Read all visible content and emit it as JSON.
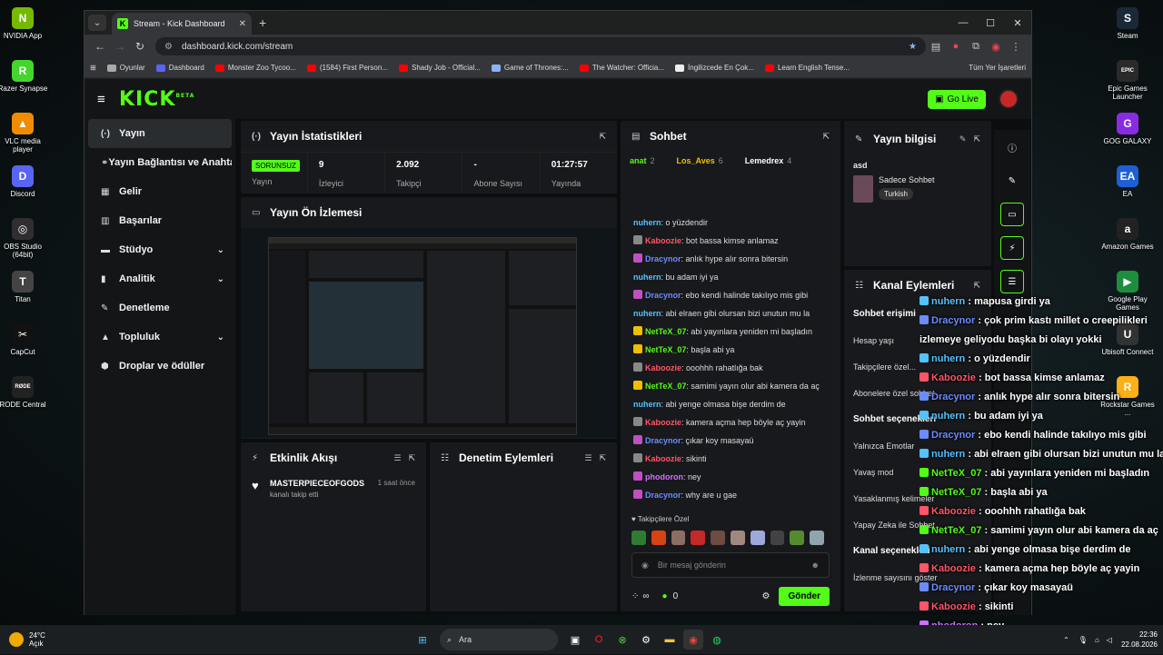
{
  "desktop_left": [
    {
      "label": "NVIDIA App",
      "icon": "nvidia-icon",
      "color": "#76b900",
      "glyph": "N"
    },
    {
      "label": "Razer Synapse",
      "icon": "razer-icon",
      "color": "#44d62c",
      "glyph": "R"
    },
    {
      "label": "VLC media player",
      "icon": "vlc-icon",
      "color": "#f08c00",
      "glyph": "▲"
    },
    {
      "label": "Discord",
      "icon": "discord-icon",
      "color": "#5865f2",
      "glyph": "D"
    },
    {
      "label": "OBS Studio (64bit)",
      "icon": "obs-icon",
      "color": "#302e31",
      "glyph": "◎"
    },
    {
      "label": "Titan",
      "icon": "titan-icon",
      "color": "#444444",
      "glyph": "T"
    },
    {
      "label": "CapCut",
      "icon": "capcut-icon",
      "color": "#111111",
      "glyph": "✂"
    },
    {
      "label": "RODE Central",
      "icon": "rode-icon",
      "color": "#222222",
      "glyph": "RØDE"
    }
  ],
  "desktop_right": [
    {
      "label": "Steam",
      "icon": "steam-icon",
      "color": "#1b2838",
      "glyph": "S"
    },
    {
      "label": "Epic Games Launcher",
      "icon": "epic-icon",
      "color": "#2a2a2a",
      "glyph": "EPIC"
    },
    {
      "label": "GOG GALAXY",
      "icon": "gog-icon",
      "color": "#8a2be2",
      "glyph": "G"
    },
    {
      "label": "EA",
      "icon": "ea-icon",
      "color": "#1f5fd6",
      "glyph": "EA"
    },
    {
      "label": "Amazon Games",
      "icon": "amazon-games-icon",
      "color": "#222222",
      "glyph": "a"
    },
    {
      "label": "Google Play Games",
      "icon": "play-games-icon",
      "color": "#1e8e3e",
      "glyph": "▶"
    },
    {
      "label": "Ubisoft Connect",
      "icon": "ubisoft-icon",
      "color": "#333333",
      "glyph": "U"
    },
    {
      "label": "Rockstar Games ...",
      "icon": "rockstar-icon",
      "color": "#fcaf17",
      "glyph": "R"
    }
  ],
  "browser": {
    "tab_title": "Stream - Kick Dashboard",
    "url": "dashboard.kick.com/stream",
    "bookmarks": [
      {
        "label": "Oyunlar",
        "color": "#aaaaaa"
      },
      {
        "label": "Dashboard",
        "color": "#5865f2"
      },
      {
        "label": "Monster Zoo Tycoo...",
        "color": "#ff0000"
      },
      {
        "label": "(1584) First Person...",
        "color": "#ff0000"
      },
      {
        "label": "Shady Job - Official...",
        "color": "#ff0000"
      },
      {
        "label": "Game of Thrones:...",
        "color": "#8ab4f8"
      },
      {
        "label": "The Watcher: Officia...",
        "color": "#ff0000"
      },
      {
        "label": "İngilizcede En Çok...",
        "color": "#eeeeee"
      },
      {
        "label": "Learn English Tense...",
        "color": "#ff0000"
      }
    ],
    "bookmarks_all": "Tüm Yer İşaretleri"
  },
  "kick": {
    "logo": "KICK",
    "logo_beta": "BETA",
    "go_live": "Go Live",
    "sidebar": [
      {
        "label": "Yayın",
        "icon": "broadcast-icon",
        "active": true,
        "chevron": false
      },
      {
        "label": "Yayın Bağlantısı ve Anahtar",
        "icon": "link-icon",
        "active": false,
        "chevron": false
      },
      {
        "label": "Gelir",
        "icon": "revenue-icon",
        "active": false,
        "chevron": false
      },
      {
        "label": "Başarılar",
        "icon": "achievements-icon",
        "active": false,
        "chevron": false
      },
      {
        "label": "Stüdyo",
        "icon": "studio-icon",
        "active": false,
        "chevron": true
      },
      {
        "label": "Analitik",
        "icon": "analytics-icon",
        "active": false,
        "chevron": true
      },
      {
        "label": "Denetleme",
        "icon": "moderation-icon",
        "active": false,
        "chevron": false
      },
      {
        "label": "Topluluk",
        "icon": "community-icon",
        "active": false,
        "chevron": true
      },
      {
        "label": "Droplar ve ödüller",
        "icon": "drops-icon",
        "active": false,
        "chevron": false
      }
    ],
    "stats": {
      "title": "Yayın İstatistikleri",
      "status": "SORUNSUZ",
      "status_label": "Yayın",
      "viewers": "9",
      "viewers_label": "İzleyici",
      "followers": "2.092",
      "followers_label": "Takipçi",
      "subs": "-",
      "subs_label": "Abone Sayısı",
      "duration": "01:27:57",
      "duration_label": "Yayında"
    },
    "preview_title": "Yayın Ön İzlemesi",
    "activity": {
      "title": "Etkinlik Akışı",
      "items": [
        {
          "name": "MASTERPIECEOFGODS",
          "sub": "kanalı takip etti",
          "time": "1 saat önce"
        }
      ]
    },
    "mod_actions_title": "Denetim Eylemleri",
    "chat": {
      "title": "Sohbet",
      "leaders": [
        {
          "name": "anat",
          "count": "2",
          "color": "#53fc18"
        },
        {
          "name": "Los_Aves",
          "count": "6",
          "color": "#f0c000"
        },
        {
          "name": "Lemedrex",
          "count": "4",
          "color": "#ffffff"
        }
      ],
      "messages": [
        {
          "user": "nuhern",
          "text": "o yüzdendir",
          "color": "#53c2ff",
          "badge": ""
        },
        {
          "user": "Kaboozie",
          "text": "bot bassa kimse anlamaz",
          "color": "#ff5566",
          "badge": "#888888"
        },
        {
          "user": "Dracynor",
          "text": "anlık hype alır sonra bitersin",
          "color": "#6a8cff",
          "badge": "#c050c0"
        },
        {
          "user": "nuhern",
          "text": "bu adam iyi ya",
          "color": "#53c2ff",
          "badge": ""
        },
        {
          "user": "Dracynor",
          "text": "ebo kendi halinde takılıyo mis gibi",
          "color": "#6a8cff",
          "badge": "#c050c0"
        },
        {
          "user": "nuhern",
          "text": "abi elraen gibi olursan bizi unutun mu la",
          "color": "#53c2ff",
          "badge": ""
        },
        {
          "user": "NetTeX_07",
          "text": "abi yayınlara yeniden mi başladın",
          "color": "#53fc18",
          "badge": "#f0c000"
        },
        {
          "user": "NetTeX_07",
          "text": "başla abi ya",
          "color": "#53fc18",
          "badge": "#f0c000"
        },
        {
          "user": "Kaboozie",
          "text": "ooohhh rahatlığa bak",
          "color": "#ff5566",
          "badge": "#888888"
        },
        {
          "user": "NetTeX_07",
          "text": "samimi yayın olur abi kamera da aç",
          "color": "#53fc18",
          "badge": "#f0c000"
        },
        {
          "user": "nuhern",
          "text": "abi yenge olmasa bişe derdim de",
          "color": "#53c2ff",
          "badge": ""
        },
        {
          "user": "Kaboozie",
          "text": "kamera açma hep böyle aç yayin",
          "color": "#ff5566",
          "badge": "#888888"
        },
        {
          "user": "Dracynor",
          "text": "çıkar koy masayaü",
          "color": "#6a8cff",
          "badge": "#c050c0"
        },
        {
          "user": "Kaboozie",
          "text": "sikinti",
          "color": "#ff5566",
          "badge": "#888888"
        },
        {
          "user": "phodoron",
          "text": "ney",
          "color": "#d070ff",
          "badge": "#c050c0"
        },
        {
          "user": "Dracynor",
          "text": "why are u gae",
          "color": "#6a8cff",
          "badge": "#c050c0"
        }
      ],
      "followers_only": "Takipçilere Özel",
      "input_placeholder": "Bir mesaj gönderin",
      "infinity": "∞",
      "points": "0",
      "send": "Gönder"
    },
    "stream_info": {
      "title": "Yayın bilgisi",
      "stream_title": "asd",
      "category": "Sadece Sohbet",
      "tag": "Turkish"
    },
    "channel_actions": {
      "title": "Kanal Eylemleri",
      "rows": [
        {
          "text": "Sohbet erişimi",
          "header": true
        },
        {
          "text": "Hesap yaşı",
          "header": false
        },
        {
          "text": "Takipçilere özel...",
          "header": false
        },
        {
          "text": "Abonelere özel sohbet",
          "header": false
        },
        {
          "text": "Sohbet seçenekleri",
          "header": true
        },
        {
          "text": "Yalnızca Emotlar",
          "header": false
        },
        {
          "text": "Yavaş mod",
          "header": false
        },
        {
          "text": "Yasaklanmış kelimeler",
          "header": false
        },
        {
          "text": "Yapay Zeka ile Sohbet...",
          "header": false
        },
        {
          "text": "Kanal seçenekleri",
          "header": true
        },
        {
          "text": "İzlenme sayısını göster",
          "header": false
        }
      ]
    }
  },
  "overlay": [
    {
      "user": "nuhern",
      "text": "mapusa girdi ya",
      "color": "#53c2ff"
    },
    {
      "user": "Dracynor",
      "text": "çok prim kastı millet o creepilikleri",
      "color": "#6a8cff"
    },
    {
      "user": "",
      "text": "izlemeye geliyodu başka bi olayı yokki",
      "color": "#ffffff"
    },
    {
      "user": "nuhern",
      "text": "o yüzdendir",
      "color": "#53c2ff"
    },
    {
      "user": "Kaboozie",
      "text": "bot bassa kimse anlamaz",
      "color": "#ff5566"
    },
    {
      "user": "Dracynor",
      "text": "anlık hype alır sonra bitersin",
      "color": "#6a8cff"
    },
    {
      "user": "nuhern",
      "text": "bu adam iyi ya",
      "color": "#53c2ff"
    },
    {
      "user": "Dracynor",
      "text": "ebo kendi halinde takılıyo mis gibi",
      "color": "#6a8cff"
    },
    {
      "user": "nuhern",
      "text": "abi elraen gibi olursan bizi unutun mu la",
      "color": "#53c2ff"
    },
    {
      "user": "NetTeX_07",
      "text": "abi yayınlara yeniden mi başladın",
      "color": "#53fc18"
    },
    {
      "user": "NetTeX_07",
      "text": "başla abi ya",
      "color": "#53fc18"
    },
    {
      "user": "Kaboozie",
      "text": "ooohhh rahatlığa bak",
      "color": "#ff5566"
    },
    {
      "user": "NetTeX_07",
      "text": "samimi yayın olur abi kamera da aç",
      "color": "#53fc18"
    },
    {
      "user": "nuhern",
      "text": "abi yenge olmasa bişe derdim de",
      "color": "#53c2ff"
    },
    {
      "user": "Kaboozie",
      "text": "kamera açma hep böyle aç yayin",
      "color": "#ff5566"
    },
    {
      "user": "Dracynor",
      "text": "çıkar koy masayaü",
      "color": "#6a8cff"
    },
    {
      "user": "Kaboozie",
      "text": "sikinti",
      "color": "#ff5566"
    },
    {
      "user": "phodoron",
      "text": "ney",
      "color": "#d070ff"
    },
    {
      "user": "Dracynor",
      "text": "why are u gae",
      "color": "#6a8cff"
    }
  ],
  "taskbar": {
    "temp": "24°C",
    "condition": "Açık",
    "search": "Ara",
    "time": "22:36",
    "date": "22.08.2026"
  }
}
